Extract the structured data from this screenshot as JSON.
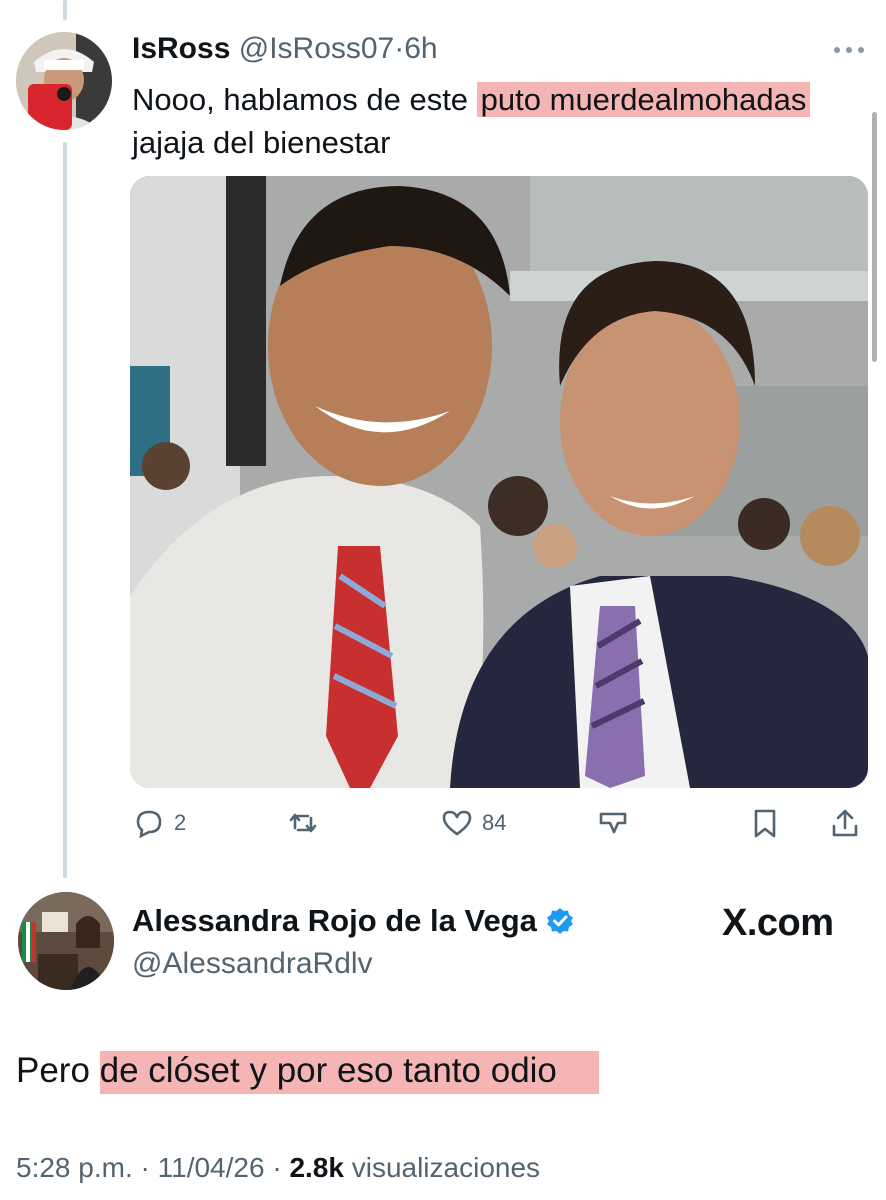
{
  "reply_tweet": {
    "author_name": "IsRoss",
    "author_handle": "@IsRoss07",
    "separator": "·",
    "time": "6h",
    "text_before": "Nooo, hablamos de este ",
    "text_highlight": "puto muerdealmohadas",
    "text_after": " jajaja del bienestar",
    "highlight_color": "#f6b5b5",
    "media_description": "photo",
    "actions": {
      "replies": "2",
      "likes": "84",
      "reply_icon": "speech-bubble-icon",
      "retweet_icon": "retweet-icon",
      "like_icon": "heart-icon",
      "stats_icon": "stats-icon",
      "bookmark_icon": "bookmark-icon",
      "share_icon": "share-icon"
    }
  },
  "main_tweet": {
    "author_name": "Alessandra Rojo de la Vega",
    "author_handle": "@AlessandraRdlv",
    "verified_color": "#1d9bf0",
    "brand": "X.com",
    "text_before": "Pero ",
    "text_highlight": "de clóset y por eso tanto odio",
    "time": "5:28 p.m.",
    "date": "11/04/26",
    "sep": "·",
    "views_count": "2.8k",
    "views_label": " visualizaciones"
  },
  "colors": {
    "text": "#0f1419",
    "secondary": "#536471",
    "thread_line": "#cfd9de"
  }
}
